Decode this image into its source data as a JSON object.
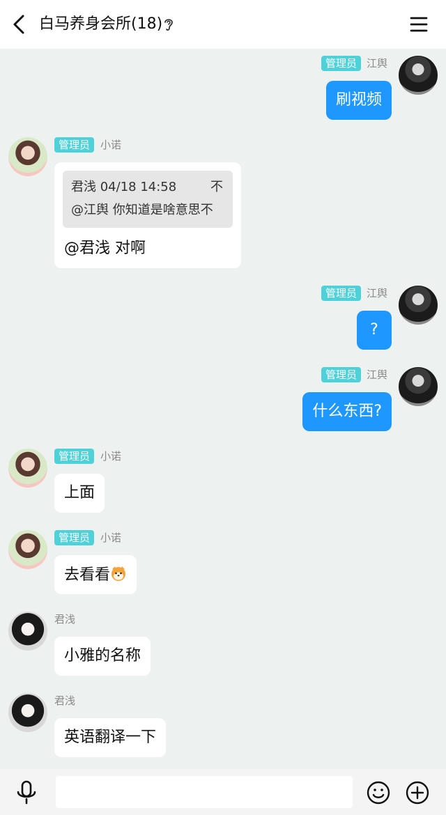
{
  "header": {
    "title": "白马养身会所(18)",
    "icons": [
      "back-arrow-icon",
      "ear-icon",
      "menu-icon"
    ]
  },
  "messages": [
    {
      "side": "mine",
      "sender": "江舆",
      "role": "管理员",
      "text": "刷视频"
    },
    {
      "side": "other",
      "sender": "小诺",
      "role": "管理员",
      "quote": {
        "head": "君浅 04/18 14:58",
        "tail": "不",
        "body": "@江舆 你知道是啥意思不"
      },
      "text": "@君浅 对啊"
    },
    {
      "side": "mine",
      "sender": "江舆",
      "role": "管理员",
      "text": "?"
    },
    {
      "side": "mine",
      "sender": "江舆",
      "role": "管理员",
      "text": "什么东西?"
    },
    {
      "side": "other",
      "sender": "小诺",
      "role": "管理员",
      "text": "上面"
    },
    {
      "side": "other",
      "sender": "小诺",
      "role": "管理员",
      "text": "去看看",
      "emoji": "shiba-emoji-icon"
    },
    {
      "side": "other",
      "sender": "君浅",
      "role": "",
      "text": "小雅的名称"
    },
    {
      "side": "other",
      "sender": "君浅",
      "role": "",
      "text": "英语翻译一下"
    }
  ],
  "composer": {
    "value": "",
    "placeholder": "",
    "icons": [
      "microphone-icon",
      "emoji-icon",
      "plus-icon"
    ]
  },
  "colors": {
    "accent_blue": "#1e98ff",
    "badge_teal": "#4fd1d9",
    "background": "#edf1ef"
  }
}
